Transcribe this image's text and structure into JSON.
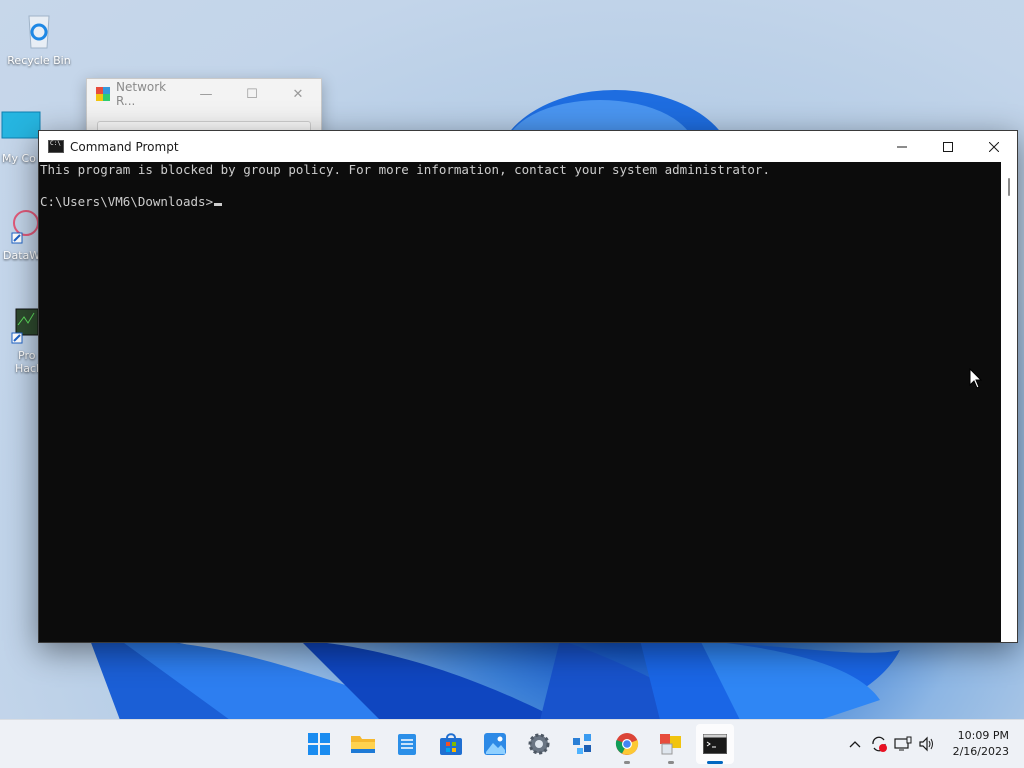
{
  "desktop": {
    "icons": [
      {
        "label": "Recycle Bin"
      },
      {
        "label": "My Co"
      },
      {
        "label": "DataW"
      },
      {
        "label": "Pro",
        "label2": "Hack"
      }
    ]
  },
  "background_window": {
    "title": "Network R...",
    "minimize_glyph": "—",
    "maximize_glyph": "☐",
    "close_glyph": "✕"
  },
  "cmd_window": {
    "title": "Command Prompt",
    "icon_text": "C:\\",
    "console_lines": [
      "This program is blocked by group policy. For more information, contact your system administrator.",
      "",
      "C:\\Users\\VM6\\Downloads>"
    ]
  },
  "taskbar": {
    "items": [
      "start",
      "file-explorer",
      "notepad",
      "microsoft-store",
      "photos",
      "settings",
      "network-tool",
      "chrome",
      "app",
      "command-prompt"
    ],
    "clock": {
      "time": "10:09 PM",
      "date": "2/16/2023"
    }
  },
  "colors": {
    "accent": "#0067c0",
    "console_bg": "#0c0c0c",
    "console_text": "#cccccc"
  }
}
